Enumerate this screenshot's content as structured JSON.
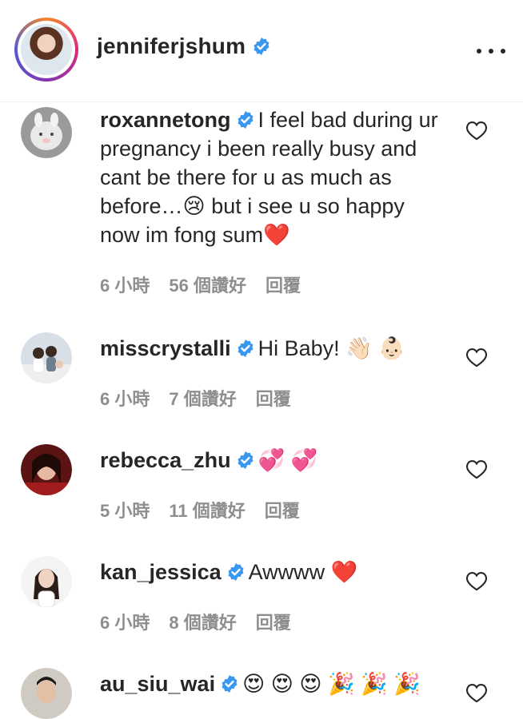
{
  "post_author": {
    "username": "jenniferjshum",
    "verified": true
  },
  "comments": [
    {
      "username": "roxannetong",
      "text": "I feel bad during ur pregnancy i been really busy and cant be there for u as much as before…😢  but i see u so happy now im fong sum❤️",
      "time": "6 小時",
      "likes": "56 個讚好",
      "reply": "回覆"
    },
    {
      "username": "misscrystalli",
      "text": "Hi Baby! 👋🏻 👶🏻",
      "time": "6 小時",
      "likes": "7 個讚好",
      "reply": "回覆"
    },
    {
      "username": "rebecca_zhu",
      "text": "💞 💞",
      "time": "5 小時",
      "likes": "11 個讚好",
      "reply": "回覆"
    },
    {
      "username": "kan_jessica",
      "text": "Awwww ❤️",
      "time": "6 小時",
      "likes": "8 個讚好",
      "reply": "回覆"
    },
    {
      "username": "au_siu_wai",
      "text": "😍 😍 😍 🎉 🎉 🎉"
    }
  ],
  "colors": {
    "text": "#262626",
    "meta": "#8e8e8e",
    "verified": "#3897f0"
  },
  "icons": [
    "verified-badge-icon",
    "more-options-icon",
    "heart-outline-icon"
  ]
}
